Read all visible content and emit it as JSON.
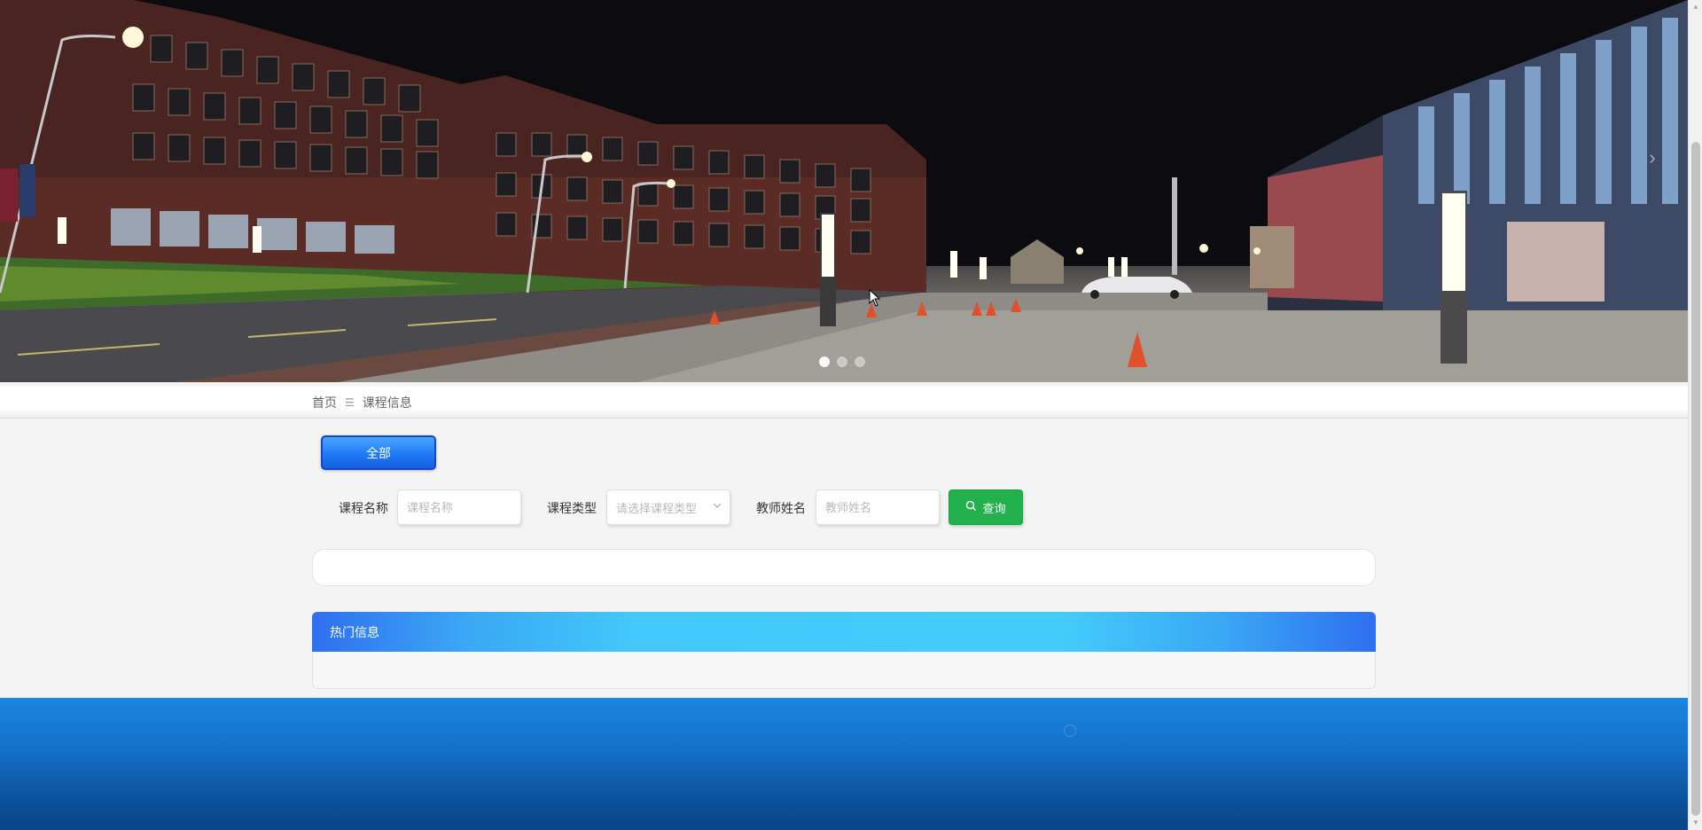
{
  "banner": {
    "slide_count": 3,
    "active_slide": 1,
    "next_arrow": "›"
  },
  "breadcrumb": {
    "home": "首页",
    "separator": "☰",
    "current": "课程信息"
  },
  "category_filter": {
    "all_label": "全部"
  },
  "filters": {
    "course_name_label": "课程名称",
    "course_name_placeholder": "课程名称",
    "course_type_label": "课程类型",
    "course_type_placeholder": "请选择课程类型",
    "teacher_name_label": "教师姓名",
    "teacher_name_placeholder": "教师姓名",
    "search_label": "查询"
  },
  "hot_section": {
    "title": "热门信息"
  },
  "colors": {
    "primary_blue": "#1f7af5",
    "search_green": "#22b14c",
    "footer_blue": "#1470c8"
  }
}
